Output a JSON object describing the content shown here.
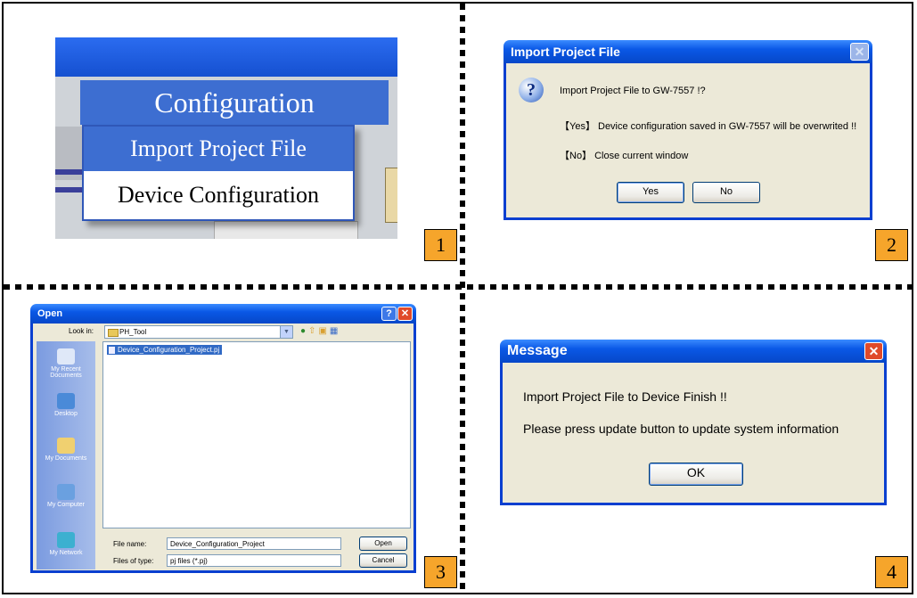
{
  "panel1": {
    "menu_title": "Configuration",
    "items": [
      "Import Project File",
      "Device Configuration"
    ],
    "step": "1"
  },
  "panel2": {
    "title": "Import Project File",
    "icon": "question-icon",
    "line1": "Import Project File to GW-7557 !?",
    "line2": "【Yes】 Device configuration saved in GW-7557 will be overwrited !!",
    "line3": "【No】 Close current window",
    "yes_label": "Yes",
    "no_label": "No",
    "step": "2"
  },
  "panel3": {
    "title": "Open",
    "look_in_label": "Look in:",
    "look_in_value": "PH_Tool",
    "places": [
      "My Recent Documents",
      "Desktop",
      "My Documents",
      "My Computer",
      "My Network"
    ],
    "files": [
      "Device_Configuration_Project.pj"
    ],
    "file_name_label": "File name:",
    "file_name_value": "Device_Configuration_Project",
    "file_type_label": "Files of type:",
    "file_type_value": "pj files (*.pj)",
    "open_label": "Open",
    "cancel_label": "Cancel",
    "step": "3"
  },
  "panel4": {
    "title": "Message",
    "line1": "Import Project File to Device Finish !!",
    "line2": "Please press update button to update system information",
    "ok_label": "OK",
    "step": "4"
  }
}
